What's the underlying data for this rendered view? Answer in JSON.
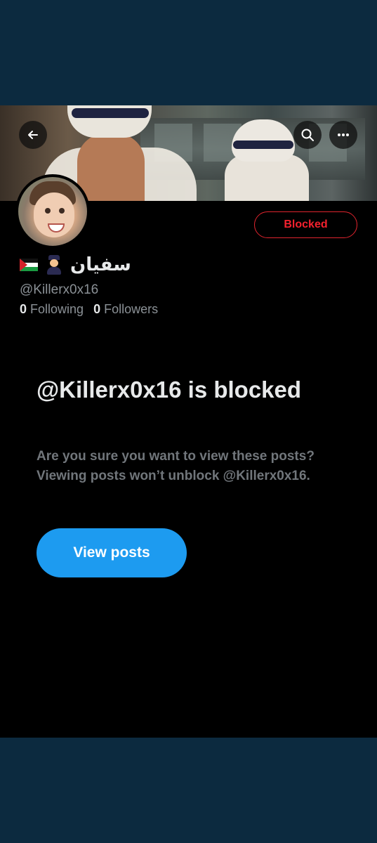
{
  "profile": {
    "display_name": "سفيان",
    "handle": "@Killerx0x16",
    "following_count": "0",
    "following_label": "Following",
    "followers_count": "0",
    "followers_label": "Followers"
  },
  "header": {
    "back_icon": "arrow-left-icon",
    "search_icon": "search-icon",
    "more_icon": "more-horizontal-icon"
  },
  "actions": {
    "blocked_label": "Blocked",
    "view_posts_label": "View posts"
  },
  "blocked_notice": {
    "title": "@Killerx0x16 is blocked",
    "description": "Are you sure you want to view these posts? Viewing posts won’t unblock @Killerx0x16."
  },
  "colors": {
    "background": "#000000",
    "outer": "#0c2a3f",
    "accent_blue": "#1d9bf0",
    "blocked_red": "#f4212e",
    "muted_text": "#71767b"
  }
}
